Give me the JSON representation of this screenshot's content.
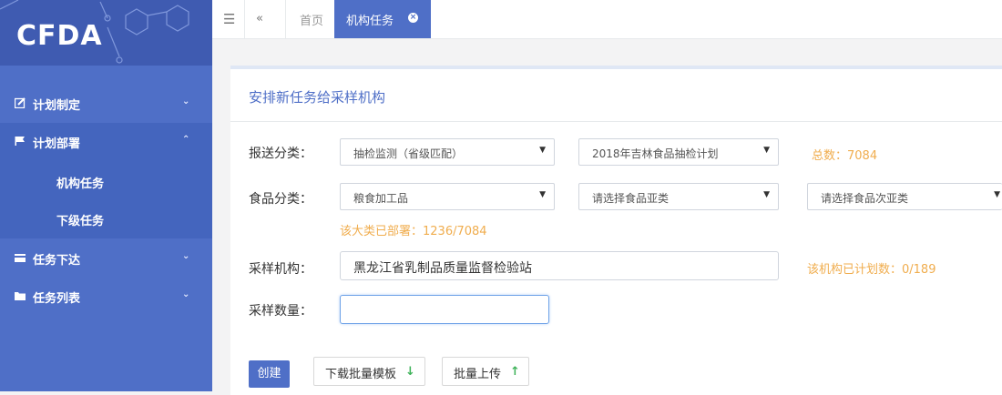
{
  "brand": {
    "logo_text": "CFDA"
  },
  "sidebar": {
    "items": [
      {
        "label": "计划制定",
        "icon": "edit-icon",
        "chevron": "⌄"
      },
      {
        "label": "计划部署",
        "icon": "flag-icon",
        "chevron": "⌃",
        "children": [
          {
            "label": "机构任务"
          },
          {
            "label": "下级任务"
          }
        ]
      },
      {
        "label": "任务下达",
        "icon": "card-icon",
        "chevron": "⌄"
      },
      {
        "label": "任务列表",
        "icon": "folder-icon",
        "chevron": "⌄"
      }
    ]
  },
  "topbar": {
    "menu_icon": "hamburger-icon",
    "back_icon": "double-chevron-left-icon",
    "tabs": [
      {
        "label": "首页"
      },
      {
        "label": "机构任务",
        "active": true,
        "close": "×"
      }
    ]
  },
  "panel": {
    "title": "安排新任务给采样机构",
    "send_category": {
      "label": "报送分类：",
      "select1": "抽检监测（省级匹配）",
      "select2": "2018年吉林食品抽检计划",
      "total": "总数：7084"
    },
    "food_category": {
      "label": "食品分类：",
      "select1": "粮食加工品",
      "select2": "请选择食品亚类",
      "select3": "请选择食品次亚类",
      "deployed": "该大类已部署：1236/7084"
    },
    "institution": {
      "label": "采样机构：",
      "value": "黑龙江省乳制品质量监督检验站",
      "planned": "该机构已计划数：0/189"
    },
    "quantity": {
      "label": "采样数量：",
      "value": ""
    },
    "buttons": {
      "create": "创建",
      "download": "下载批量模板",
      "upload": "批量上传"
    }
  },
  "colors": {
    "primary": "#4f6fc7",
    "warning": "#f0ad4e",
    "success": "#3fb35a"
  }
}
